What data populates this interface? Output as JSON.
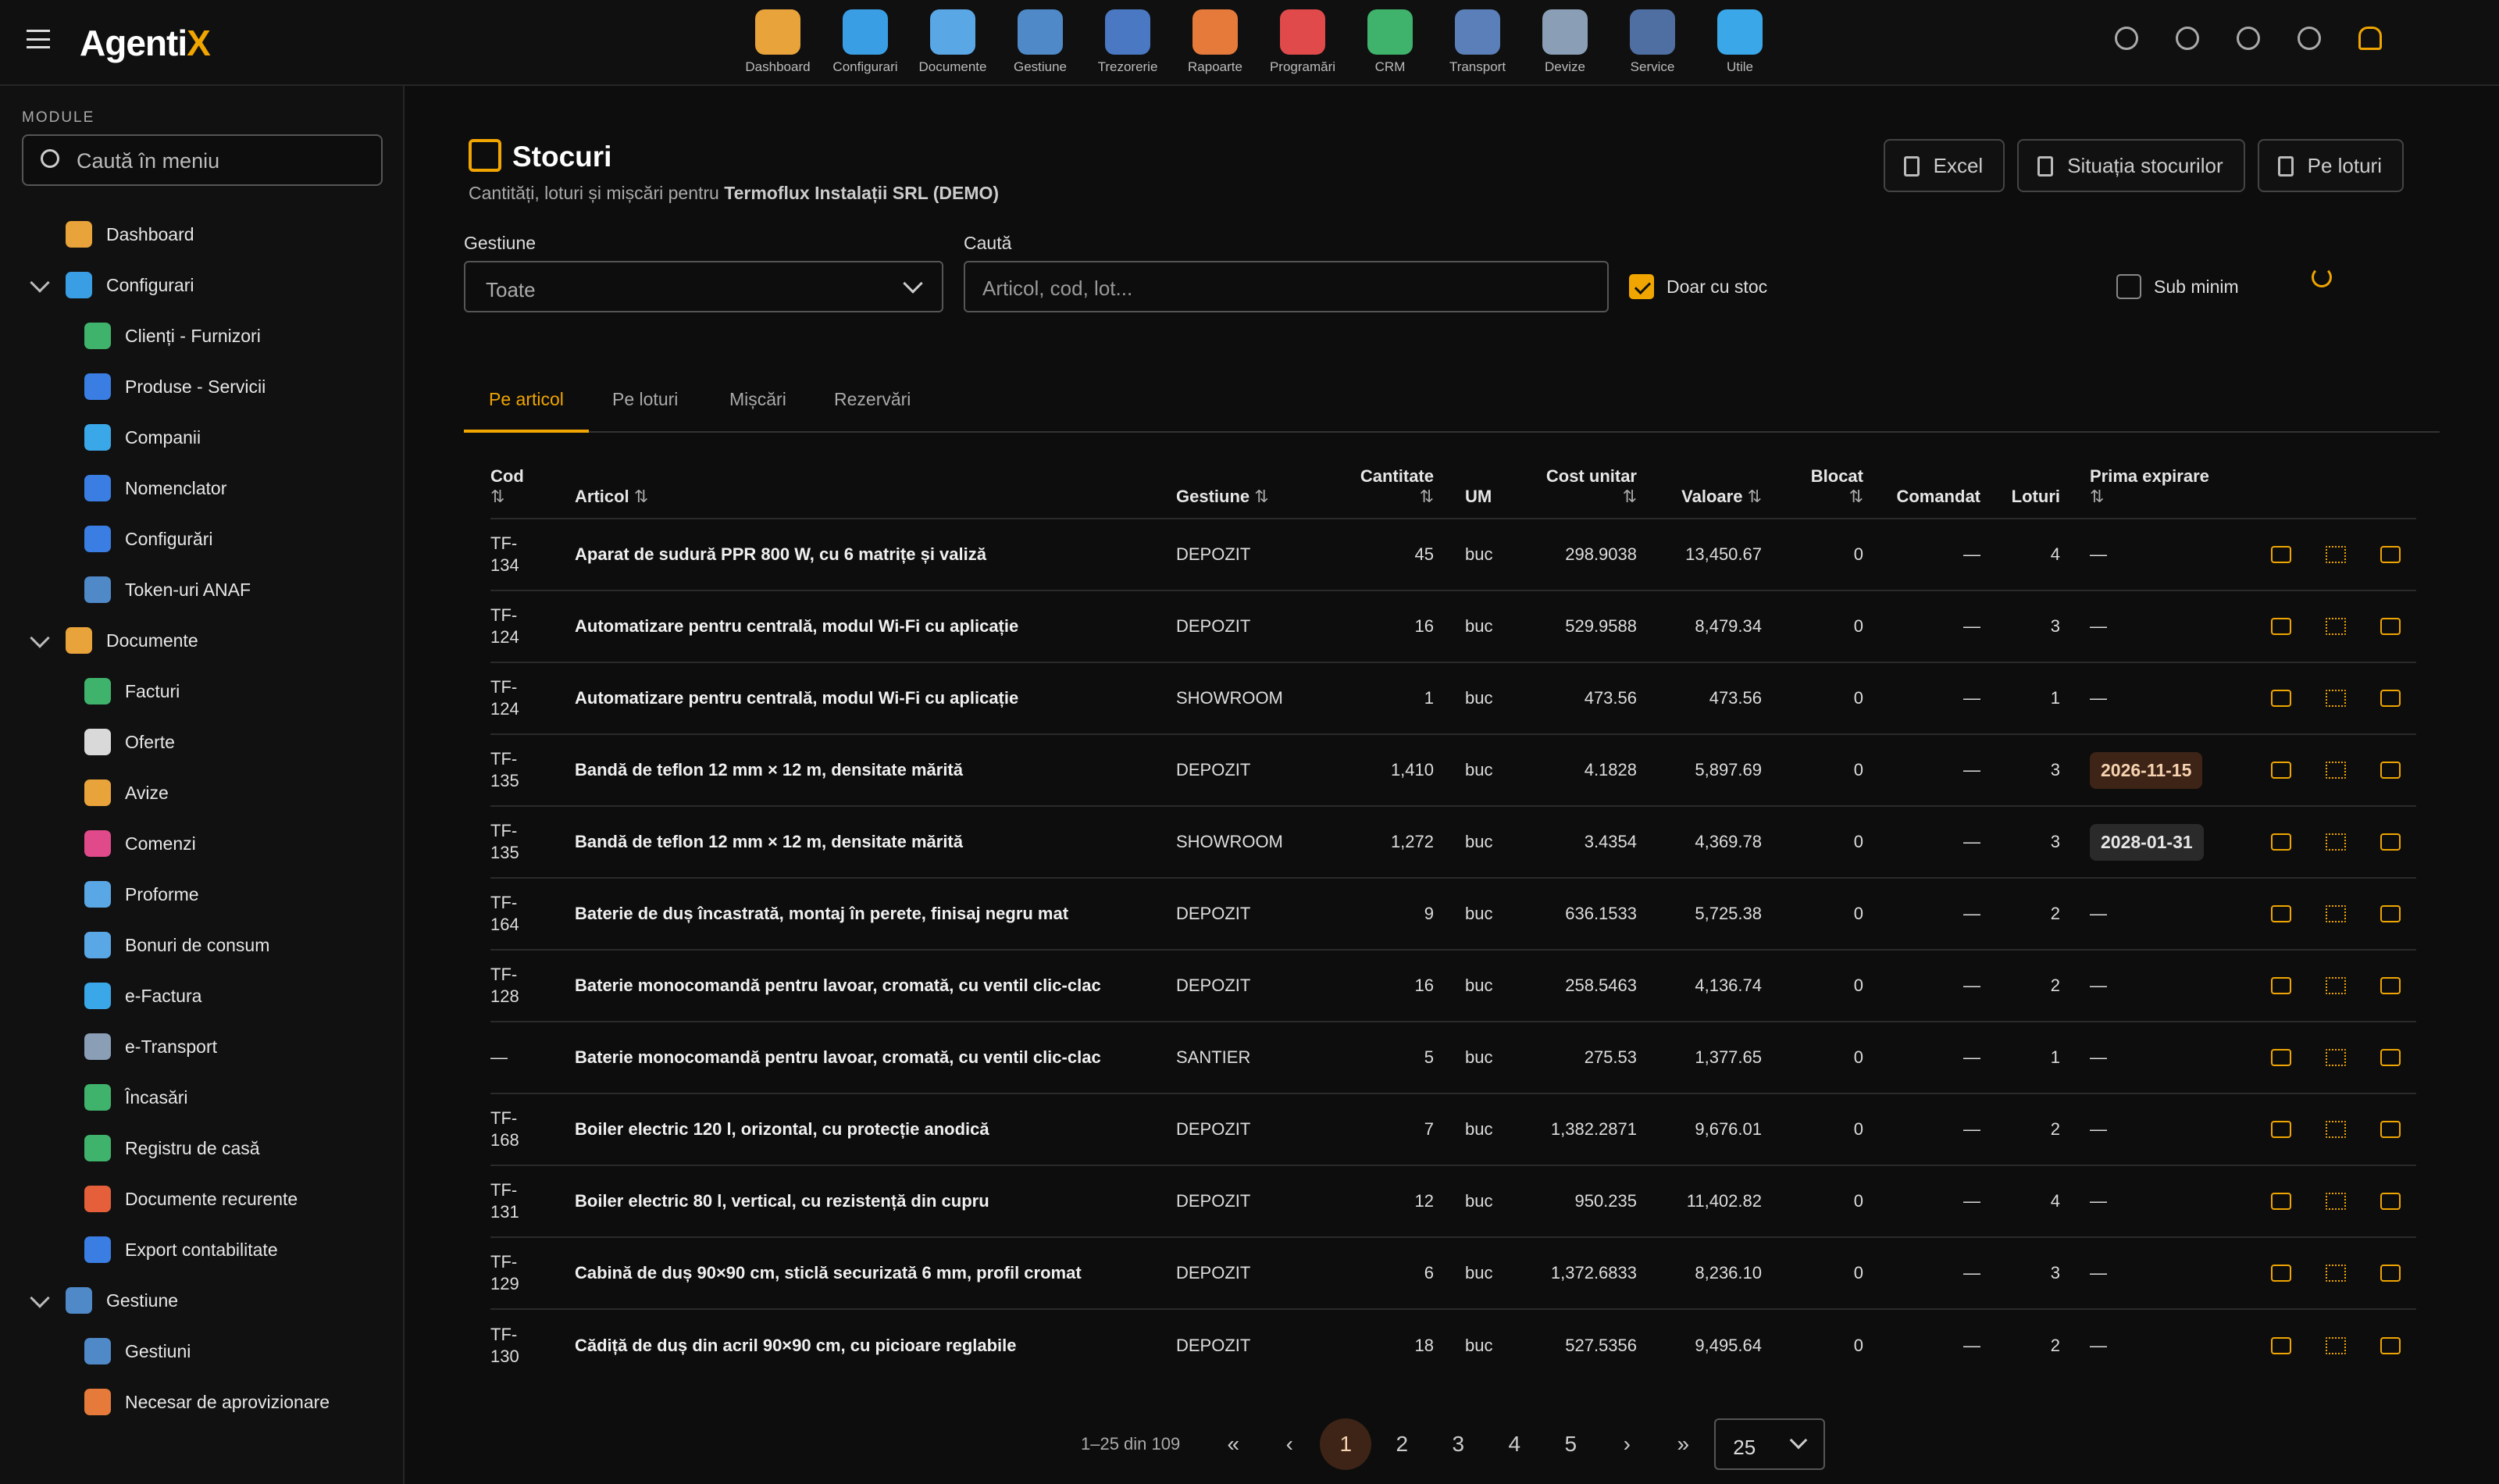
{
  "app": {
    "logo_main": "Agenti",
    "logo_accent": "X"
  },
  "modules": [
    {
      "label": "Dashboard",
      "icon": "dashboard-icon",
      "color": "#e9a33b"
    },
    {
      "label": "Configurari",
      "icon": "gear-icon",
      "color": "#3a9ee4"
    },
    {
      "label": "Documente",
      "icon": "documents-icon",
      "color": "#5aa7e6"
    },
    {
      "label": "Gestiune",
      "icon": "warehouse-icon",
      "color": "#4f89c8"
    },
    {
      "label": "Trezorerie",
      "icon": "bank-icon",
      "color": "#4a78c2"
    },
    {
      "label": "Rapoarte",
      "icon": "report-icon",
      "color": "#e57a3a"
    },
    {
      "label": "Programări",
      "icon": "clock-icon",
      "color": "#e04a4a"
    },
    {
      "label": "CRM",
      "icon": "crm-icon",
      "color": "#3fb36b"
    },
    {
      "label": "Transport",
      "icon": "truck-icon",
      "color": "#5b7fb8"
    },
    {
      "label": "Devize",
      "icon": "estimate-icon",
      "color": "#8a9fb5"
    },
    {
      "label": "Service",
      "icon": "service-icon",
      "color": "#4f6fa3"
    },
    {
      "label": "Utile",
      "icon": "help-icon",
      "color": "#3aa7e8"
    }
  ],
  "sidebar": {
    "section_label": "MODULE",
    "search_placeholder": "Caută în meniu",
    "items": [
      {
        "label": "Dashboard",
        "level": 0,
        "color": "#e9a33b"
      },
      {
        "label": "Configurari",
        "level": 0,
        "expanded": true,
        "color": "#3a9ee4"
      },
      {
        "label": "Clienți - Furnizori",
        "level": 1,
        "color": "#3fb36b"
      },
      {
        "label": "Produse - Servicii",
        "level": 1,
        "color": "#3a7ee4"
      },
      {
        "label": "Companii",
        "level": 1,
        "color": "#3aa7e8"
      },
      {
        "label": "Nomenclator",
        "level": 1,
        "color": "#3a7ee4"
      },
      {
        "label": "Configurări",
        "level": 1,
        "color": "#3a7ee4"
      },
      {
        "label": "Token-uri ANAF",
        "level": 1,
        "color": "#4f89c8"
      },
      {
        "label": "Documente",
        "level": 0,
        "expanded": true,
        "color": "#e9a33b"
      },
      {
        "label": "Facturi",
        "level": 1,
        "color": "#3fb36b"
      },
      {
        "label": "Oferte",
        "level": 1,
        "color": "#d9d9d9"
      },
      {
        "label": "Avize",
        "level": 1,
        "color": "#e9a33b"
      },
      {
        "label": "Comenzi",
        "level": 1,
        "color": "#e04a8a"
      },
      {
        "label": "Proforme",
        "level": 1,
        "color": "#5aa7e6"
      },
      {
        "label": "Bonuri de consum",
        "level": 1,
        "color": "#5aa7e6"
      },
      {
        "label": "e-Factura",
        "level": 1,
        "color": "#3aa7e8"
      },
      {
        "label": "e-Transport",
        "level": 1,
        "color": "#8a9fb5"
      },
      {
        "label": "Încasări",
        "level": 1,
        "color": "#3fb36b"
      },
      {
        "label": "Registru de casă",
        "level": 1,
        "color": "#3fb36b"
      },
      {
        "label": "Documente recurente",
        "level": 1,
        "color": "#e5603a"
      },
      {
        "label": "Export contabilitate",
        "level": 1,
        "color": "#3a7ee4"
      },
      {
        "label": "Gestiune",
        "level": 0,
        "expanded": true,
        "color": "#4f89c8"
      },
      {
        "label": "Gestiuni",
        "level": 1,
        "color": "#4f89c8"
      },
      {
        "label": "Necesar de aprovizionare",
        "level": 1,
        "color": "#e57a3a"
      }
    ]
  },
  "page": {
    "title": "Stocuri",
    "subtitle_prefix": "Cantități, loturi și mișcări pentru ",
    "company": "Termoflux Instalații SRL (DEMO)",
    "buttons": {
      "excel": "Excel",
      "situatie": "Situația stocurilor",
      "loturi": "Pe loturi"
    }
  },
  "filters": {
    "gestiune_label": "Gestiune",
    "gestiune_value": "Toate",
    "cauta_label": "Caută",
    "cauta_placeholder": "Articol, cod, lot...",
    "doar_stoc_label": "Doar cu stoc",
    "doar_stoc_checked": true,
    "sub_minim_label": "Sub minim",
    "sub_minim_checked": false
  },
  "tabs": [
    "Pe articol",
    "Pe loturi",
    "Mișcări",
    "Rezervări"
  ],
  "table": {
    "headers": {
      "cod": "Cod",
      "articol": "Articol",
      "gestiune": "Gestiune",
      "cantitate": "Cantitate",
      "um": "UM",
      "cost": "Cost unitar",
      "valoare": "Valoare",
      "blocat": "Blocat",
      "comandat": "Comandat",
      "loturi": "Loturi",
      "expirare": "Prima expirare",
      "sort": "⇅"
    },
    "rows": [
      {
        "cod": [
          "TF-",
          "134"
        ],
        "articol": "Aparat de sudură PPR 800 W, cu 6 matrițe și valiză",
        "gestiune": "DEPOZIT",
        "cantitate": "45",
        "um": "buc",
        "cost": "298.9038",
        "valoare": "13,450.67",
        "blocat": "0",
        "comandat": "—",
        "loturi": "4",
        "exp": "—",
        "exp_style": ""
      },
      {
        "cod": [
          "TF-",
          "124"
        ],
        "articol": "Automatizare pentru centrală, modul Wi-Fi cu aplicație",
        "gestiune": "DEPOZIT",
        "cantitate": "16",
        "um": "buc",
        "cost": "529.9588",
        "valoare": "8,479.34",
        "blocat": "0",
        "comandat": "—",
        "loturi": "3",
        "exp": "—",
        "exp_style": ""
      },
      {
        "cod": [
          "TF-",
          "124"
        ],
        "articol": "Automatizare pentru centrală, modul Wi-Fi cu aplicație",
        "gestiune": "SHOWROOM",
        "cantitate": "1",
        "um": "buc",
        "cost": "473.56",
        "valoare": "473.56",
        "blocat": "0",
        "comandat": "—",
        "loturi": "1",
        "exp": "—",
        "exp_style": ""
      },
      {
        "cod": [
          "TF-",
          "135"
        ],
        "articol": "Bandă de teflon 12 mm × 12 m, densitate mărită",
        "gestiune": "DEPOZIT",
        "cantitate": "1,410",
        "um": "buc",
        "cost": "4.1828",
        "valoare": "5,897.69",
        "blocat": "0",
        "comandat": "—",
        "loturi": "3",
        "exp": "2026-11-15",
        "exp_style": "badge"
      },
      {
        "cod": [
          "TF-",
          "135"
        ],
        "articol": "Bandă de teflon 12 mm × 12 m, densitate mărită",
        "gestiune": "SHOWROOM",
        "cantitate": "1,272",
        "um": "buc",
        "cost": "3.4354",
        "valoare": "4,369.78",
        "blocat": "0",
        "comandat": "—",
        "loturi": "3",
        "exp": "2028-01-31",
        "exp_style": "badge dk"
      },
      {
        "cod": [
          "TF-",
          "164"
        ],
        "articol": "Baterie de duș încastrată, montaj în perete, finisaj negru mat",
        "gestiune": "DEPOZIT",
        "cantitate": "9",
        "um": "buc",
        "cost": "636.1533",
        "valoare": "5,725.38",
        "blocat": "0",
        "comandat": "—",
        "loturi": "2",
        "exp": "—",
        "exp_style": ""
      },
      {
        "cod": [
          "TF-",
          "128"
        ],
        "articol": "Baterie monocomandă pentru lavoar, cromată, cu ventil clic-clac",
        "gestiune": "DEPOZIT",
        "cantitate": "16",
        "um": "buc",
        "cost": "258.5463",
        "valoare": "4,136.74",
        "blocat": "0",
        "comandat": "—",
        "loturi": "2",
        "exp": "—",
        "exp_style": ""
      },
      {
        "cod": [
          "—",
          ""
        ],
        "articol": "Baterie monocomandă pentru lavoar, cromată, cu ventil clic-clac",
        "gestiune": "SANTIER",
        "cantitate": "5",
        "um": "buc",
        "cost": "275.53",
        "valoare": "1,377.65",
        "blocat": "0",
        "comandat": "—",
        "loturi": "1",
        "exp": "—",
        "exp_style": ""
      },
      {
        "cod": [
          "TF-",
          "168"
        ],
        "articol": "Boiler electric 120 l, orizontal, cu protecție anodică",
        "gestiune": "DEPOZIT",
        "cantitate": "7",
        "um": "buc",
        "cost": "1,382.2871",
        "valoare": "9,676.01",
        "blocat": "0",
        "comandat": "—",
        "loturi": "2",
        "exp": "—",
        "exp_style": ""
      },
      {
        "cod": [
          "TF-",
          "131"
        ],
        "articol": "Boiler electric 80 l, vertical, cu rezistență din cupru",
        "gestiune": "DEPOZIT",
        "cantitate": "12",
        "um": "buc",
        "cost": "950.235",
        "valoare": "11,402.82",
        "blocat": "0",
        "comandat": "—",
        "loturi": "4",
        "exp": "—",
        "exp_style": ""
      },
      {
        "cod": [
          "TF-",
          "129"
        ],
        "articol": "Cabină de duș 90×90 cm, sticlă securizată 6 mm, profil cromat",
        "gestiune": "DEPOZIT",
        "cantitate": "6",
        "um": "buc",
        "cost": "1,372.6833",
        "valoare": "8,236.10",
        "blocat": "0",
        "comandat": "—",
        "loturi": "3",
        "exp": "—",
        "exp_style": ""
      },
      {
        "cod": [
          "TF-",
          "130"
        ],
        "articol": "Cădiță de duș din acril 90×90 cm, cu picioare reglabile",
        "gestiune": "DEPOZIT",
        "cantitate": "18",
        "um": "buc",
        "cost": "527.5356",
        "valoare": "9,495.64",
        "blocat": "0",
        "comandat": "—",
        "loturi": "2",
        "exp": "—",
        "exp_style": ""
      }
    ]
  },
  "pagination": {
    "info": "1–25 din 109",
    "pages": [
      "1",
      "2",
      "3",
      "4",
      "5"
    ],
    "current": "1",
    "page_size": "25",
    "first": "«",
    "prev": "‹",
    "next": "›",
    "last": "»"
  }
}
